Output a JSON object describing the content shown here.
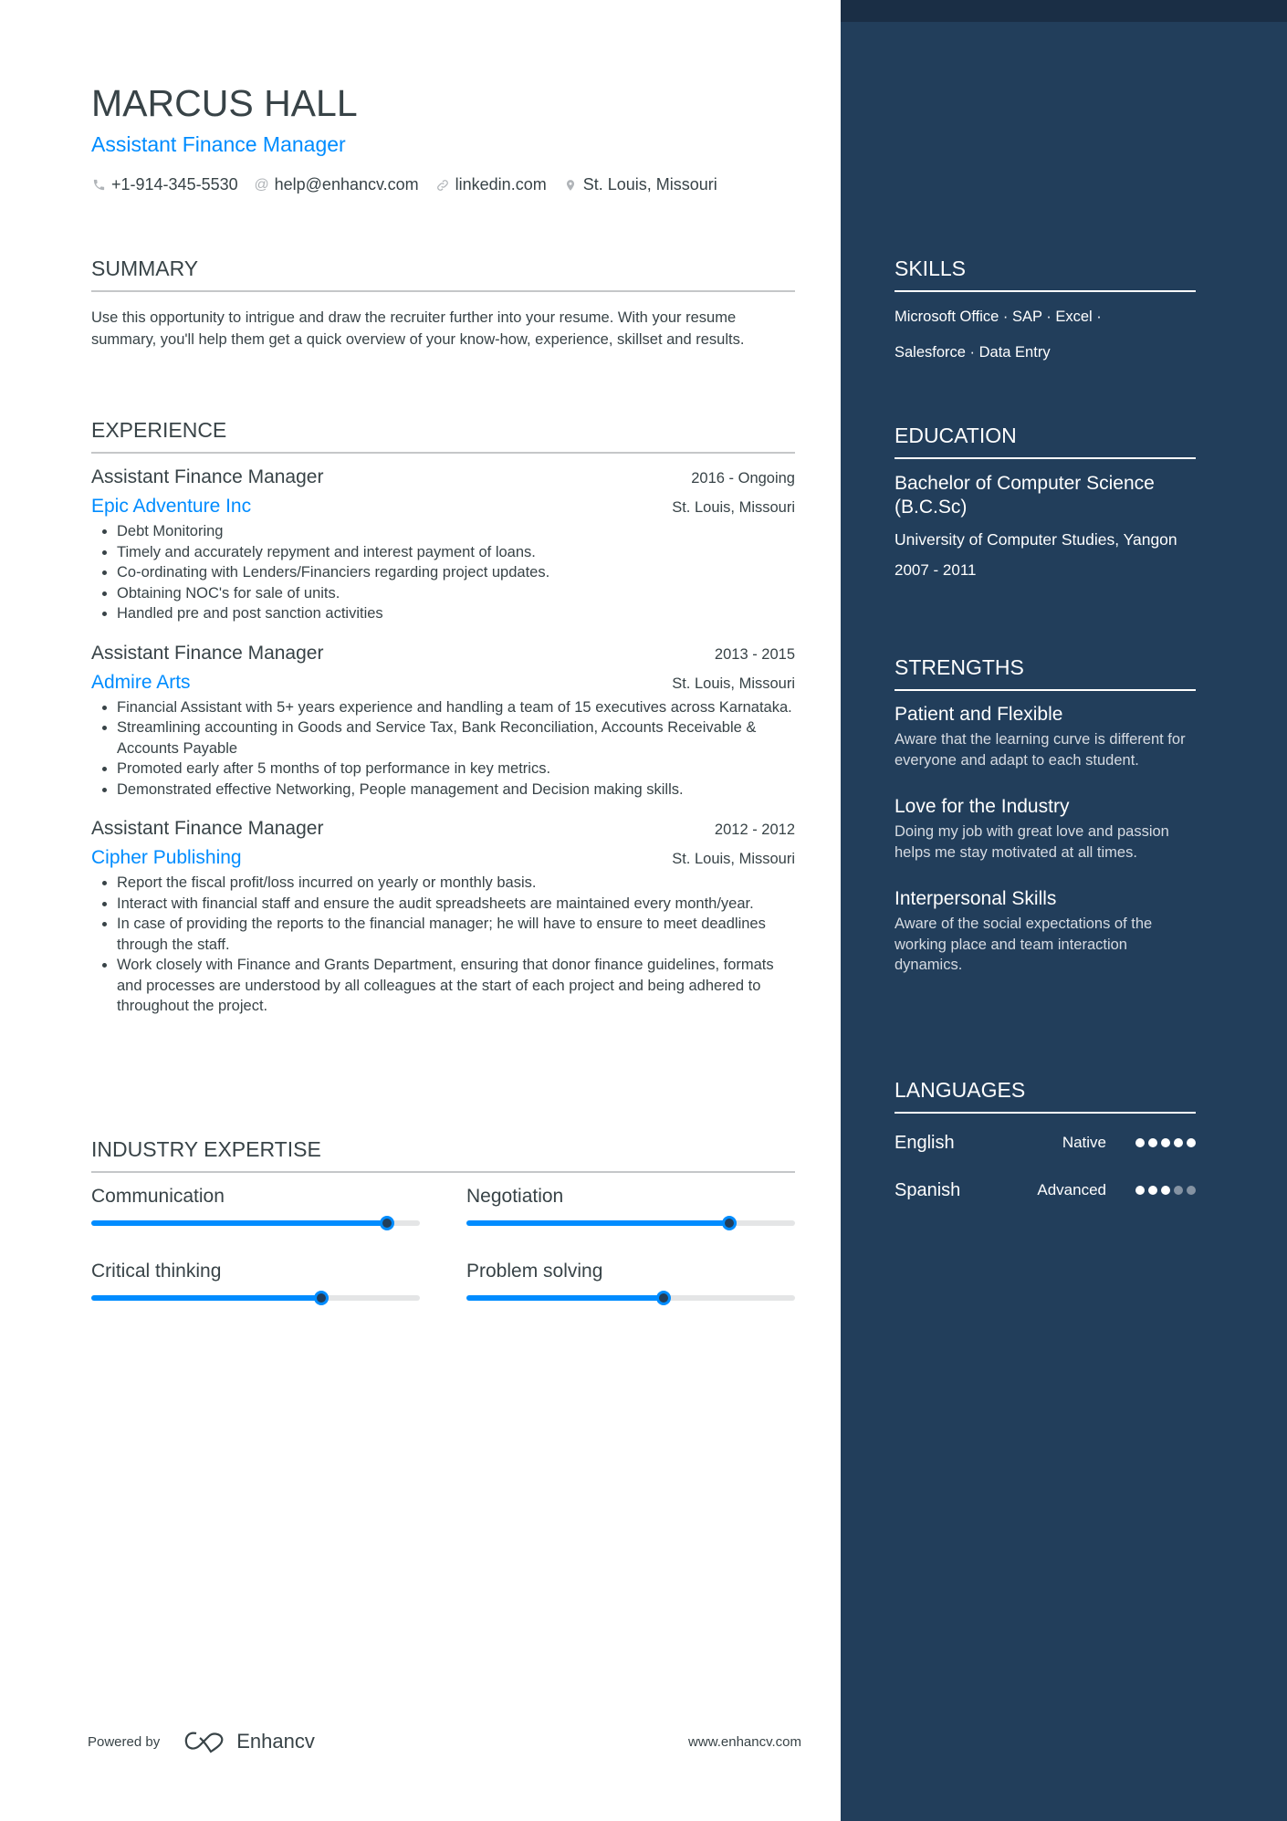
{
  "header": {
    "name": "MARCUS HALL",
    "title": "Assistant Finance Manager",
    "contacts": [
      {
        "icon": "phone-icon",
        "glyph": "✆",
        "text": "+1-914-345-5530"
      },
      {
        "icon": "at-icon",
        "glyph": "@",
        "text": "help@enhancv.com"
      },
      {
        "icon": "link-icon",
        "glyph": "⚭",
        "text": "linkedin.com"
      },
      {
        "icon": "location-pin-icon",
        "glyph": "⌖",
        "text": "St. Louis, Missouri"
      }
    ]
  },
  "summary": {
    "title": "SUMMARY",
    "text": "Use this opportunity to intrigue and draw the recruiter further into your resume. With your resume summary, you'll help them get a quick overview of your know-how, experience, skillset and results."
  },
  "experience": {
    "title": "EXPERIENCE",
    "jobs": [
      {
        "title": "Assistant Finance Manager",
        "date": "2016 - Ongoing",
        "company": "Epic Adventure Inc",
        "location": "St. Louis, Missouri",
        "bullets": [
          "Debt Monitoring",
          "Timely and accurately repyment and interest payment of loans.",
          "Co-ordinating with Lenders/Financiers regarding project updates.",
          "Obtaining NOC's for sale of units.",
          "Handled pre and post sanction activities"
        ]
      },
      {
        "title": "Assistant Finance Manager",
        "date": "2013 - 2015",
        "company": "Admire Arts",
        "location": "St. Louis, Missouri",
        "bullets": [
          " Financial Assistant with 5+ years experience and handling a team of 15 executives across Karnataka.",
          "Streamlining accounting in Goods and Service Tax, Bank Reconciliation, Accounts Receivable & Accounts Payable",
          "Promoted early after 5 months of top performance in key metrics.",
          "Demonstrated effective Networking, People management and Decision making skills."
        ]
      },
      {
        "title": "Assistant Finance Manager",
        "date": "2012 - 2012",
        "company": "Cipher Publishing",
        "location": "St. Louis, Missouri",
        "bullets": [
          "Report the fiscal profit/loss incurred on yearly or monthly basis.",
          "Interact with financial staff and ensure the audit spreadsheets are maintained every month/year.",
          "In case of providing the reports to the financial manager; he will have to ensure to meet deadlines through the staff.",
          "Work closely with Finance and Grants Department, ensuring that donor finance guidelines, formats and processes are understood by all colleagues at the start of each project and being adhered to throughout the project."
        ]
      }
    ]
  },
  "expertise": {
    "title": "INDUSTRY EXPERTISE",
    "items": [
      {
        "label": "Communication",
        "level": 0.9
      },
      {
        "label": "Negotiation",
        "level": 0.8
      },
      {
        "label": "Critical thinking",
        "level": 0.7
      },
      {
        "label": "Problem solving",
        "level": 0.6
      }
    ]
  },
  "sidebar": {
    "skills": {
      "title": "SKILLS",
      "line1": "Microsoft Office · SAP · Excel ·",
      "line2": "Salesforce · Data Entry"
    },
    "education": {
      "title": "EDUCATION",
      "degree": "Bachelor of Computer Science (B.C.Sc)",
      "school": "University of Computer Studies, Yangon",
      "date": "2007 - 2011"
    },
    "strengths": {
      "title": "STRENGTHS",
      "items": [
        {
          "title": "Patient and Flexible",
          "desc": "Aware that the learning curve is different for everyone and adapt to each student."
        },
        {
          "title": "Love for the Industry",
          "desc": "Doing my job with great love and passion helps me stay motivated at all times."
        },
        {
          "title": "Interpersonal Skills",
          "desc": "Aware of the social expectations of the working place and team interaction dynamics."
        }
      ]
    },
    "languages": {
      "title": "LANGUAGES",
      "items": [
        {
          "name": "English",
          "level": "Native",
          "rating": 5,
          "max": 5
        },
        {
          "name": "Spanish",
          "level": "Advanced",
          "rating": 3,
          "max": 5
        }
      ]
    }
  },
  "footer": {
    "powered_by": "Powered by",
    "brand": "Enhancv",
    "url": "www.enhancv.com"
  },
  "colors": {
    "accent": "#008cff",
    "sidebar": "#223e5b",
    "sidebar_top": "#1a2e45",
    "text": "#384347"
  }
}
